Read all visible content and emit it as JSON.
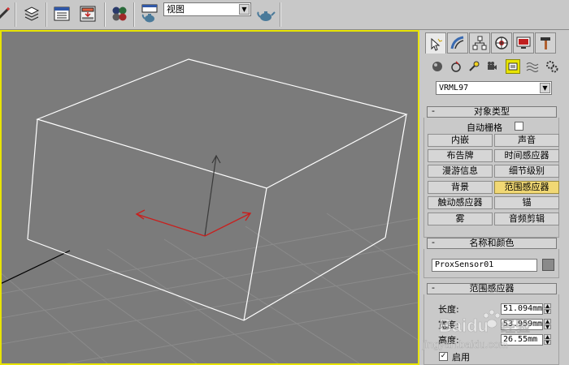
{
  "toolbar": {
    "view_dropdown": "视图",
    "icons": [
      "pencil-icon",
      "layers-icon",
      "track-view-icon",
      "schematic-view-icon",
      "material-editor-icon",
      "render-setup-icon",
      "render-teapot-icon",
      "quick-render-icon"
    ]
  },
  "command_panel": {
    "tabs": [
      "create-tab",
      "modify-tab",
      "hierarchy-tab",
      "motion-tab",
      "display-tab",
      "utilities-tab"
    ],
    "category_dropdown": "VRML97",
    "object_type": {
      "title": "对象类型",
      "autogrid_label": "自动栅格",
      "buttons": [
        "内嵌",
        "声音",
        "布告牌",
        "时间感应器",
        "漫游信息",
        "细节级别",
        "背景",
        "范围感应器",
        "触动感应器",
        "锚",
        "雾",
        "音频剪辑"
      ],
      "active_button": "范围感应器"
    },
    "name_color": {
      "title": "名称和颜色",
      "name_value": "ProxSensor01",
      "swatch_color": "#8a8a8a"
    },
    "params": {
      "title": "范围感应器",
      "length_label": "长度:",
      "length_value": "51.094mm",
      "width_label": "宽度:",
      "width_value": "53.959mm",
      "height_label": "高度:",
      "height_value": "26.55mm",
      "enabled_label": "启用"
    }
  },
  "colors": {
    "viewport_bg": "#7b7b7b",
    "viewport_border": "#e8e400",
    "wireframe": "#ffffff",
    "gizmo_x": "#c8201e",
    "active_button": "#f1d874"
  },
  "watermark": {
    "brand": "Baidu",
    "sub": "经验",
    "url": "jingyan.baidu.com"
  }
}
